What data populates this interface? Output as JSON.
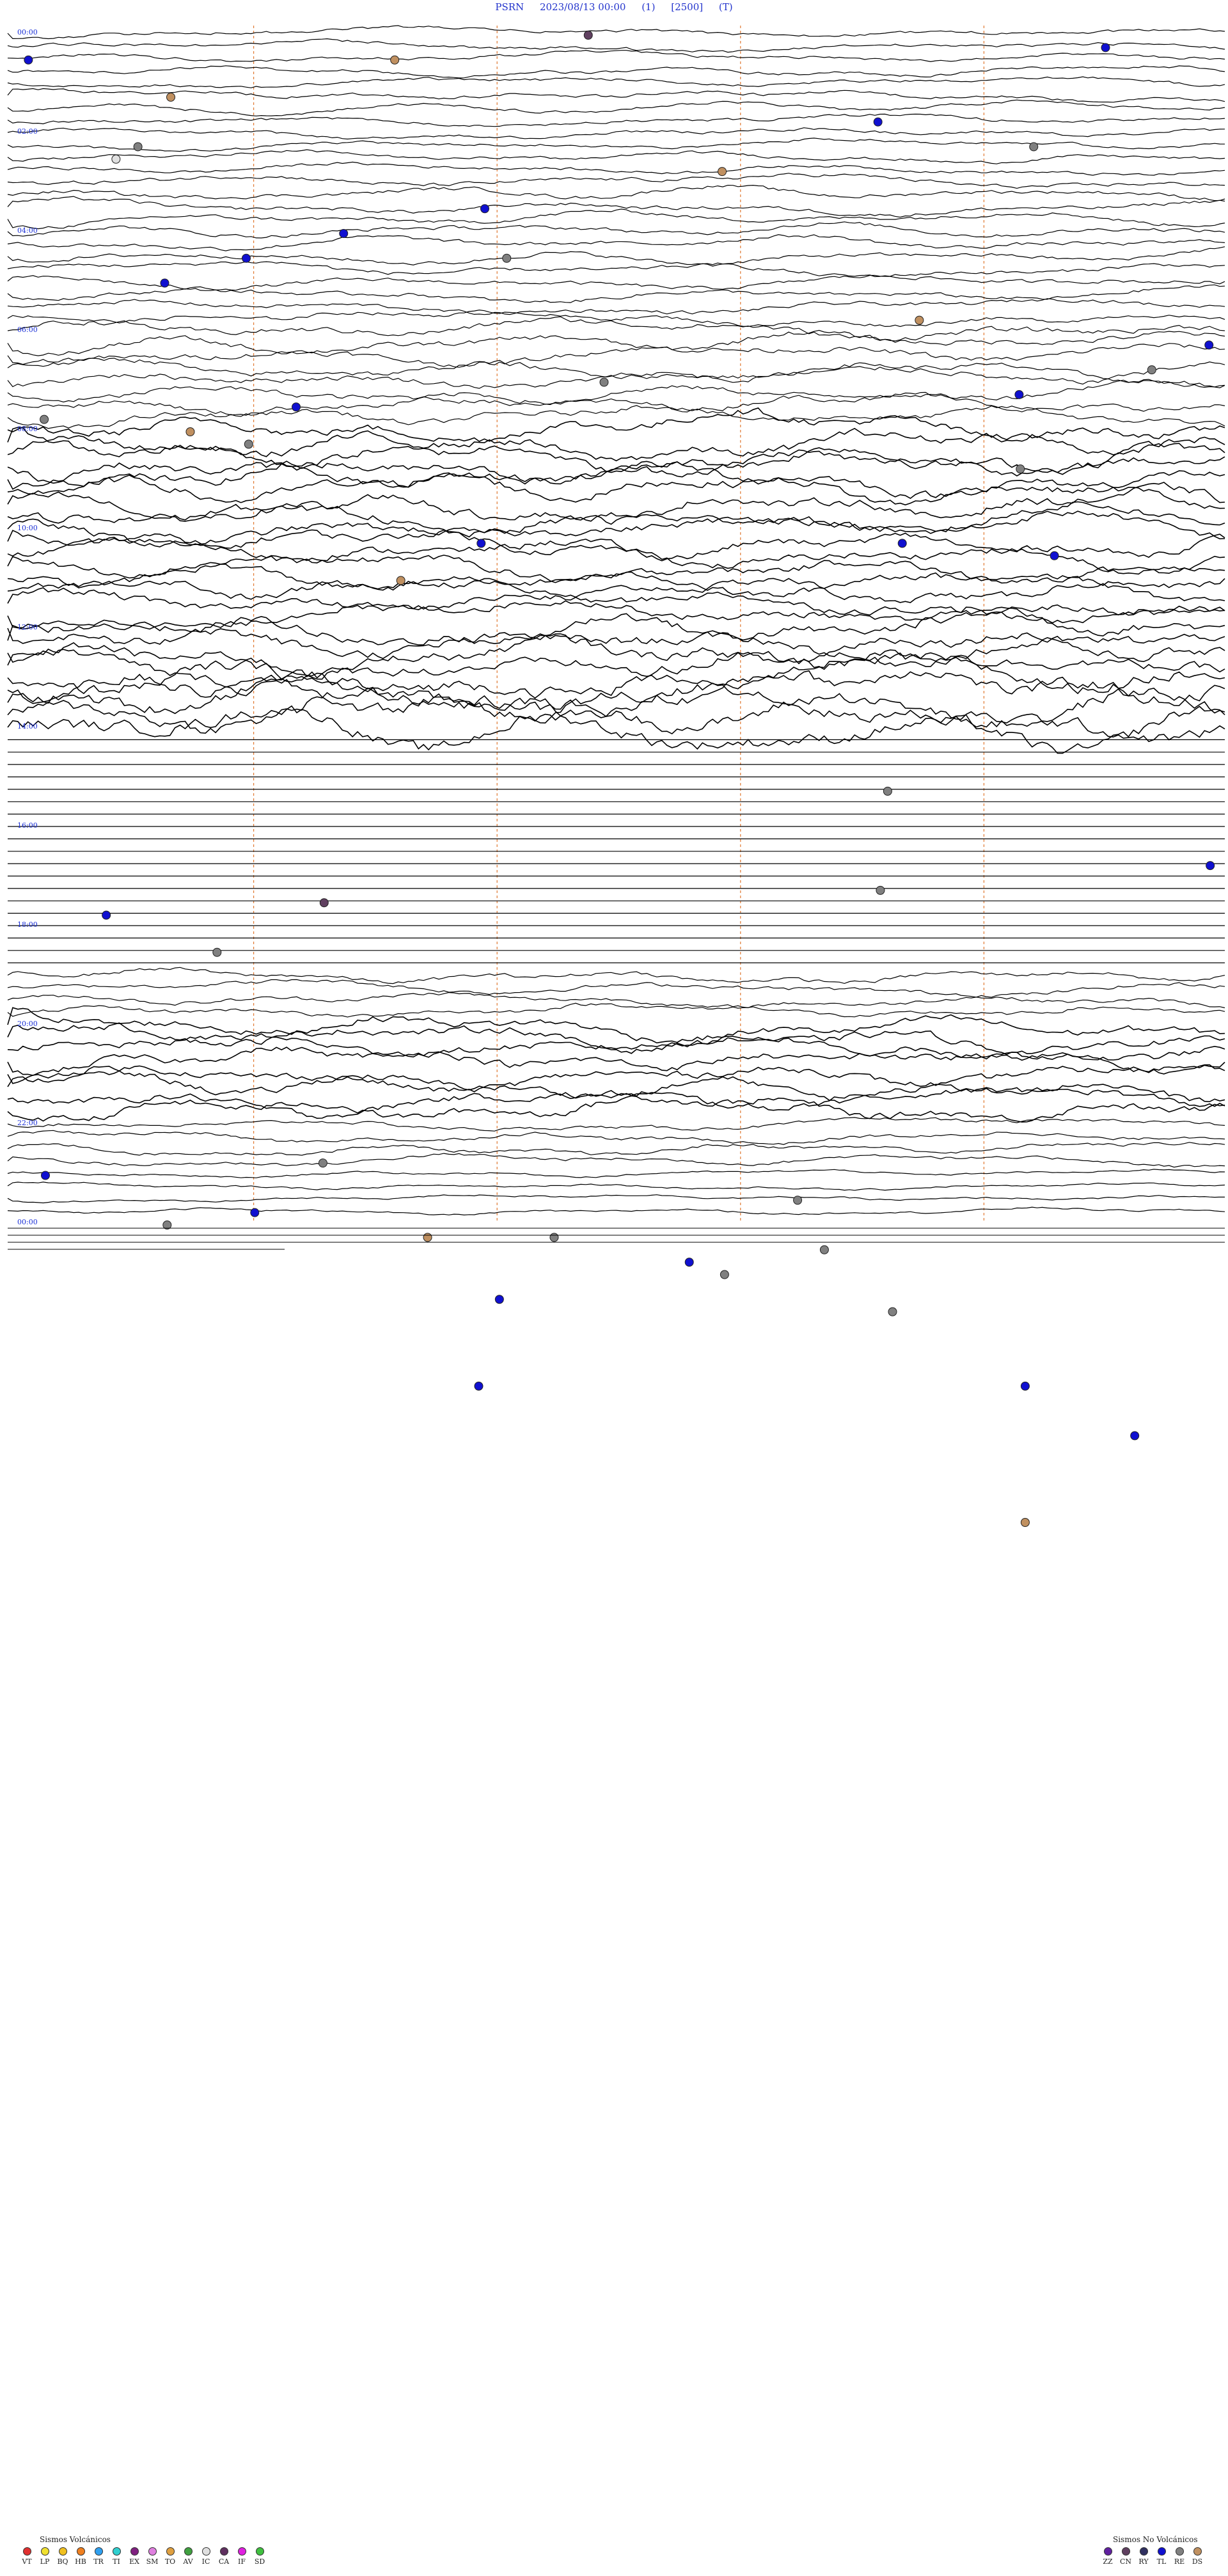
{
  "header": {
    "station": "PSRN",
    "datetime": "2023/08/13 00:00",
    "channel": "(1)",
    "scale": "[2500]",
    "mode": "(T)"
  },
  "time_labels": [
    "00:00",
    "02:00",
    "04:00",
    "06:00",
    "08:00",
    "10:00",
    "12:00",
    "14:00",
    "16:00",
    "18:00",
    "20:00",
    "22:00",
    "00:00"
  ],
  "legend": {
    "volcanic_title": "Sismos Volcánicos",
    "volcanic": [
      {
        "code": "VT",
        "color": "#e03030"
      },
      {
        "code": "LP",
        "color": "#f0e030"
      },
      {
        "code": "BQ",
        "color": "#f0c020"
      },
      {
        "code": "HB",
        "color": "#f08020"
      },
      {
        "code": "TR",
        "color": "#30a0f0"
      },
      {
        "code": "TI",
        "color": "#30d0d0"
      },
      {
        "code": "EX",
        "color": "#802080"
      },
      {
        "code": "SM",
        "color": "#e080e0"
      },
      {
        "code": "TO",
        "color": "#e0a040"
      },
      {
        "code": "AV",
        "color": "#40a040"
      },
      {
        "code": "IC",
        "color": "#e0e0e0"
      },
      {
        "code": "CA",
        "color": "#603060"
      },
      {
        "code": "IF",
        "color": "#e020e0"
      },
      {
        "code": "SD",
        "color": "#40c040"
      }
    ],
    "nonvolcanic_title": "Sismos No Volcánicos",
    "nonvolcanic": [
      {
        "code": "ZZ",
        "color": "#6020a0"
      },
      {
        "code": "CN",
        "color": "#604060"
      },
      {
        "code": "RY",
        "color": "#303060"
      },
      {
        "code": "TL",
        "color": "#1010d0"
      },
      {
        "code": "RE",
        "color": "#808080"
      },
      {
        "code": "DS",
        "color": "#c09060"
      }
    ]
  },
  "chart_data": {
    "type": "line",
    "title": "PSRN 2023/08/13 00:00 (1) [2500] (T)",
    "xlabel": "",
    "ylabel": "",
    "hours": 24,
    "lines_per_hour": 4,
    "event_markers": [
      {
        "line": 0,
        "frac": 0.477,
        "type": "CN"
      },
      {
        "line": 1,
        "frac": 0.902,
        "type": "TL"
      },
      {
        "line": 2,
        "frac": 0.017,
        "type": "TL"
      },
      {
        "line": 2,
        "frac": 0.318,
        "type": "DS"
      },
      {
        "line": 5,
        "frac": 0.134,
        "type": "DS"
      },
      {
        "line": 7,
        "frac": 0.715,
        "type": "TL"
      },
      {
        "line": 9,
        "frac": 0.107,
        "type": "RE"
      },
      {
        "line": 9,
        "frac": 0.843,
        "type": "RE"
      },
      {
        "line": 10,
        "frac": 0.089,
        "type": "IC"
      },
      {
        "line": 11,
        "frac": 0.587,
        "type": "DS"
      },
      {
        "line": 14,
        "frac": 0.392,
        "type": "TL"
      },
      {
        "line": 16,
        "frac": 0.276,
        "type": "TL"
      },
      {
        "line": 18,
        "frac": 0.41,
        "type": "RE"
      },
      {
        "line": 18,
        "frac": 0.196,
        "type": "TL"
      },
      {
        "line": 20,
        "frac": 0.129,
        "type": "TL"
      },
      {
        "line": 23,
        "frac": 0.749,
        "type": "DS"
      },
      {
        "line": 25,
        "frac": 0.987,
        "type": "TL"
      },
      {
        "line": 27,
        "frac": 0.94,
        "type": "RE"
      },
      {
        "line": 28,
        "frac": 0.49,
        "type": "RE"
      },
      {
        "line": 29,
        "frac": 0.831,
        "type": "TL"
      },
      {
        "line": 30,
        "frac": 0.237,
        "type": "TL"
      },
      {
        "line": 31,
        "frac": 0.03,
        "type": "RE"
      },
      {
        "line": 32,
        "frac": 0.15,
        "type": "DS"
      },
      {
        "line": 33,
        "frac": 0.198,
        "type": "RE"
      },
      {
        "line": 35,
        "frac": 0.832,
        "type": "RE"
      },
      {
        "line": 41,
        "frac": 0.389,
        "type": "TL"
      },
      {
        "line": 41,
        "frac": 0.735,
        "type": "TL"
      },
      {
        "line": 42,
        "frac": 0.86,
        "type": "TL"
      },
      {
        "line": 44,
        "frac": 0.323,
        "type": "DS"
      },
      {
        "line": 61,
        "frac": 0.723,
        "type": "RE"
      },
      {
        "line": 67,
        "frac": 0.988,
        "type": "TL"
      },
      {
        "line": 69,
        "frac": 0.717,
        "type": "RE"
      },
      {
        "line": 70,
        "frac": 0.26,
        "type": "CN"
      },
      {
        "line": 71,
        "frac": 0.081,
        "type": "TL"
      },
      {
        "line": 74,
        "frac": 0.172,
        "type": "RE"
      },
      {
        "line": 91,
        "frac": 0.259,
        "type": "RE"
      },
      {
        "line": 92,
        "frac": 0.031,
        "type": "TL"
      },
      {
        "line": 94,
        "frac": 0.649,
        "type": "RE"
      },
      {
        "line": 95,
        "frac": 0.203,
        "type": "TL"
      },
      {
        "line": 96,
        "frac": 0.131,
        "type": "RE"
      },
      {
        "line": 97,
        "frac": 0.345,
        "type": "DS"
      },
      {
        "line": 97,
        "frac": 0.449,
        "type": "RE"
      },
      {
        "line": 98,
        "frac": 0.671,
        "type": "RE"
      },
      {
        "line": 99,
        "frac": 0.56,
        "type": "TL"
      },
      {
        "line": 100,
        "frac": 0.589,
        "type": "RE"
      },
      {
        "line": 102,
        "frac": 0.404,
        "type": "TL"
      },
      {
        "line": 103,
        "frac": 0.727,
        "type": "RE"
      },
      {
        "line": 109,
        "frac": 0.387,
        "type": "TL"
      },
      {
        "line": 109,
        "frac": 0.836,
        "type": "TL"
      },
      {
        "line": 113,
        "frac": 0.926,
        "type": "TL"
      },
      {
        "line": 120,
        "frac": 0.836,
        "type": "DS"
      }
    ]
  }
}
